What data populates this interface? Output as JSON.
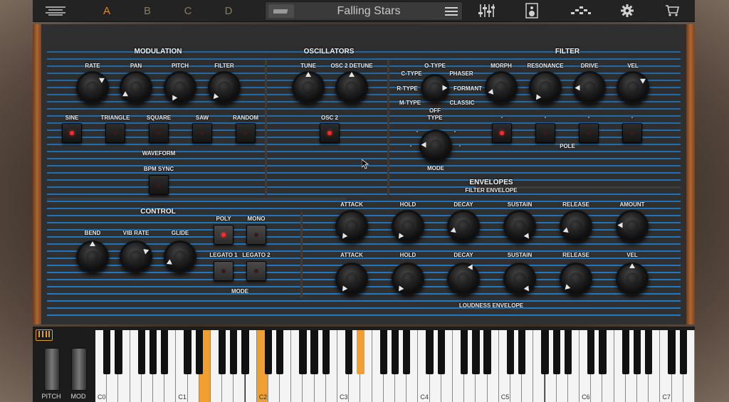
{
  "topbar": {
    "presets": [
      "A",
      "B",
      "C",
      "D"
    ],
    "active_preset": "A",
    "preset_name": "Falling Stars",
    "icons": [
      "hamburger-icon",
      "mixer-icon",
      "speaker-icon",
      "sequencer-icon",
      "gear-icon",
      "cart-icon"
    ]
  },
  "modulation": {
    "title": "MODULATION",
    "knobs": [
      "RATE",
      "PAN",
      "PITCH",
      "FILTER"
    ],
    "waveforms": [
      "SINE",
      "TRIANGLE",
      "SQUARE",
      "SAW",
      "RANDOM"
    ],
    "waveform_label": "WAVEFORM",
    "bpm_sync": "BPM SYNC"
  },
  "oscillators": {
    "title": "OSCILLATORS",
    "knobs": [
      "TUNE",
      "OSC 2 DETUNE"
    ],
    "osc2": "OSC 2"
  },
  "filter": {
    "title": "FILTER",
    "type_options": [
      "O-TYPE",
      "C-TYPE",
      "PHASER",
      "R-TYPE",
      "FORMANT",
      "M-TYPE",
      "CLASSIC",
      "OFF"
    ],
    "type_label": "TYPE",
    "knobs": [
      "MORPH",
      "RESONANCE",
      "DRIVE",
      "VEL"
    ],
    "mode_label": "MODE",
    "pole_label": "POLE",
    "mode_marks": [
      "-",
      "-",
      "-",
      "-"
    ],
    "pole_marks": [
      "-",
      "-",
      "-",
      "-"
    ]
  },
  "control": {
    "title": "CONTROL",
    "knobs": [
      "BEND",
      "VIB RATE",
      "GLIDE"
    ],
    "mode_buttons": [
      "POLY",
      "MONO",
      "LEGATO 1",
      "LEGATO 2"
    ],
    "mode_label": "MODE"
  },
  "envelopes": {
    "title": "ENVELOPES",
    "filter_env_label": "FILTER ENVELOPE",
    "filter_knobs": [
      "ATTACK",
      "HOLD",
      "DECAY",
      "SUSTAIN",
      "RELEASE",
      "AMOUNT"
    ],
    "loud_knobs": [
      "ATTACK",
      "HOLD",
      "DECAY",
      "SUSTAIN",
      "RELEASE",
      "VEL"
    ],
    "loud_env_label": "LOUDNESS ENVELOPE"
  },
  "keyboard": {
    "wheels": [
      "PITCH",
      "MOD"
    ],
    "octaves": [
      "C0",
      "C1",
      "C2",
      "C3",
      "C4",
      "C5",
      "C6",
      "C7"
    ]
  }
}
